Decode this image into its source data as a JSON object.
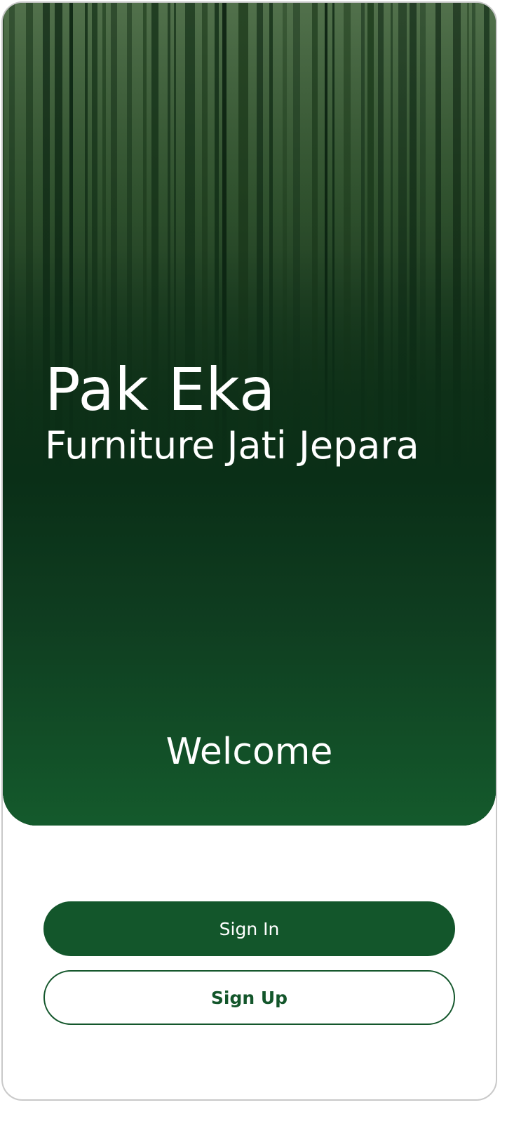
{
  "brand": {
    "name": "Pak Eka",
    "subtitle": "Furniture Jati Jepara"
  },
  "hero": {
    "background": "forest-photo",
    "welcome": "Welcome"
  },
  "actions": {
    "sign_in_label": "Sign In",
    "sign_up_label": "Sign Up"
  },
  "colors": {
    "primary": "#13562b",
    "hero_dark": "#0a2a14",
    "background": "#ffffff"
  }
}
